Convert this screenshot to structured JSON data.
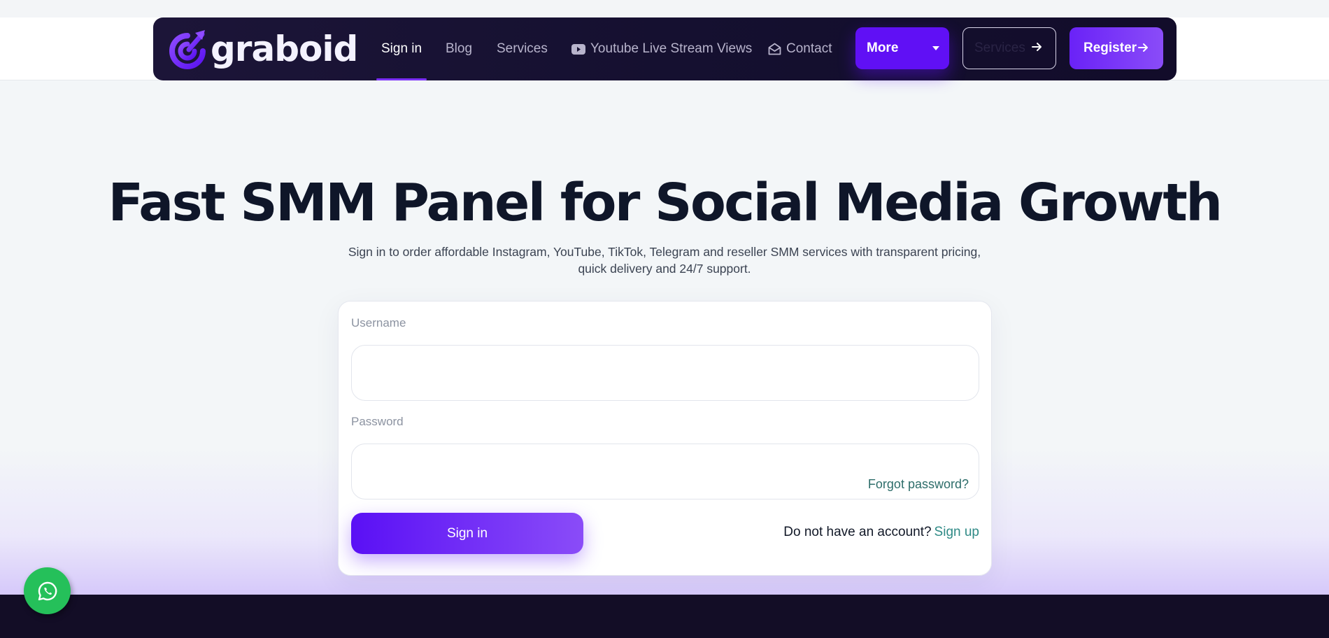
{
  "brand": {
    "name": "graboid",
    "accent": "#6010f5",
    "nav_bg": "#151030"
  },
  "nav": {
    "links": [
      {
        "label": "Sign in",
        "active": true
      },
      {
        "label": "Blog",
        "active": false
      },
      {
        "label": "Services",
        "active": false
      },
      {
        "label": "Youtube Live Stream Views",
        "active": false,
        "icon": "youtube-icon"
      },
      {
        "label": "Contact",
        "active": false,
        "icon": "envelope-open-icon"
      }
    ],
    "more_label": "More",
    "services_label": "Services",
    "register_label": "Register"
  },
  "hero": {
    "title": "Fast SMM Panel for Social Media Growth",
    "subtitle": "Sign in to order affordable Instagram, YouTube, TikTok, Telegram and reseller SMM services with transparent pricing, quick delivery and 24/7 support."
  },
  "login": {
    "username_label": "Username",
    "username_value": "",
    "password_label": "Password",
    "password_value": "",
    "forgot_label": "Forgot password?",
    "submit_label": "Sign in",
    "no_account_text": "Do not have an account?",
    "signup_label": "Sign up"
  },
  "widgets": {
    "chat_icon": "whatsapp-icon",
    "chat_color": "#25c05a"
  }
}
